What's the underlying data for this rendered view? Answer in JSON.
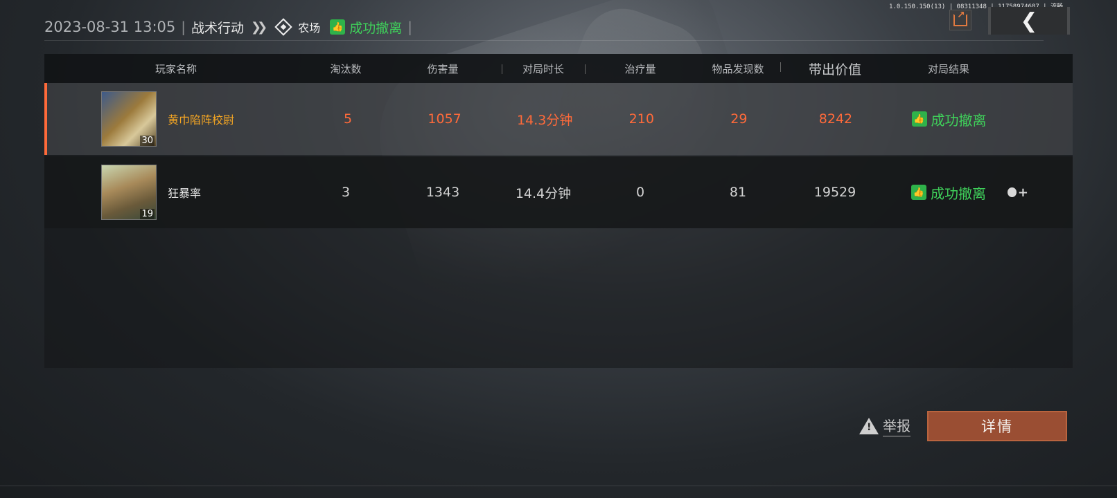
{
  "header": {
    "datetime": "2023-08-31 13:05",
    "separator": "|",
    "mode": "战术行动",
    "map": "农场",
    "result": "成功撤离"
  },
  "version_text": "1.0.150.150(13) | 08311348 | 11758974687 | 流畅",
  "table": {
    "columns": [
      "玩家名称",
      "淘汰数",
      "伤害量",
      "对局时长",
      "治疗量",
      "物品发现数",
      "带出价值",
      "对局结果"
    ],
    "rows": [
      {
        "name": "黄巾陷阵校尉",
        "level": "30",
        "kills": "5",
        "damage": "1057",
        "duration": "14.3分钟",
        "healing": "210",
        "items": "29",
        "value": "8242",
        "result": "成功撤离"
      },
      {
        "name": "狂暴率",
        "level": "19",
        "kills": "3",
        "damage": "1343",
        "duration": "14.4分钟",
        "healing": "0",
        "items": "81",
        "value": "19529",
        "result": "成功撤离"
      }
    ]
  },
  "actions": {
    "report_label": "举报",
    "detail_label": "详情"
  },
  "colors": {
    "accent_orange": "#ff6a3a",
    "success_green": "#3fcf5a",
    "detail_button": "#9a4e33"
  },
  "icons": [
    "share-icon",
    "back-arrow-icon",
    "map-marker-icon",
    "thumbs-up-icon",
    "add-friend-icon",
    "warning-icon"
  ]
}
